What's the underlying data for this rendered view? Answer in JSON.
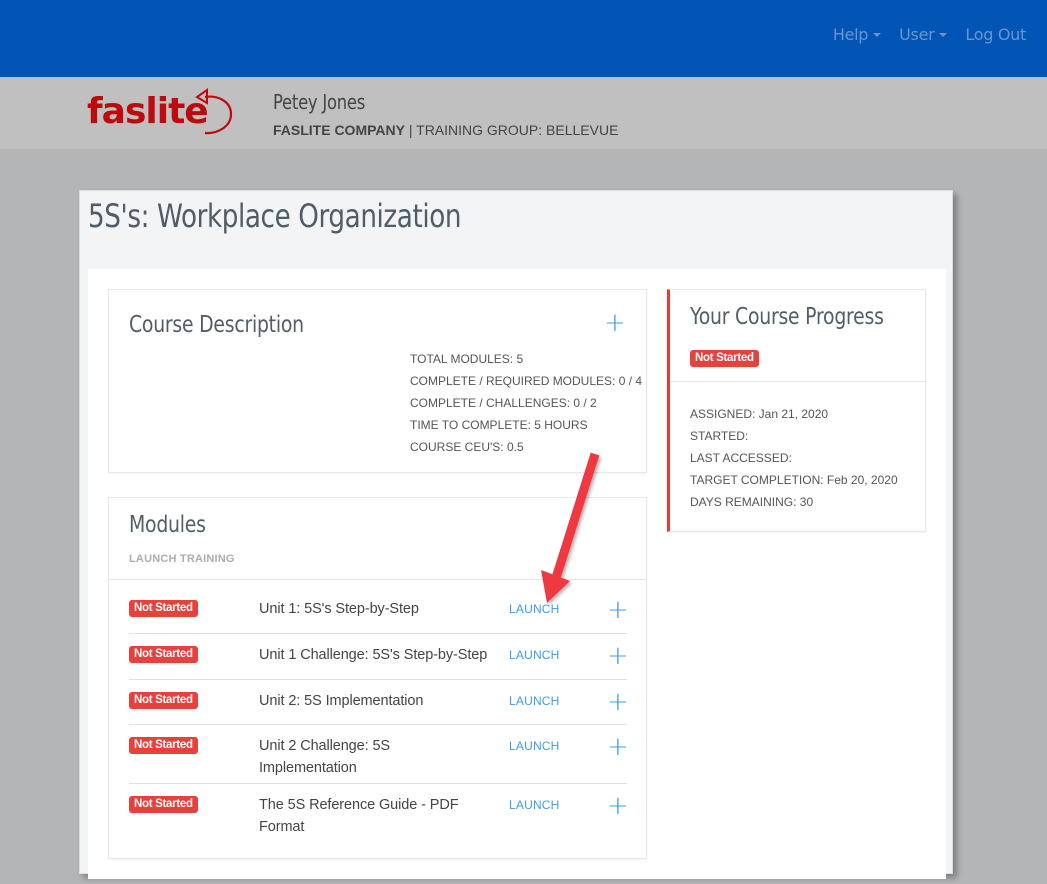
{
  "topnav": {
    "help": "Help",
    "user": "User",
    "logout": "Log Out"
  },
  "logo": {
    "text": "faslite"
  },
  "userbar": {
    "name": "Petey Jones",
    "company": "FASLITE COMPANY",
    "separator": " | ",
    "group": "TRAINING GROUP: BELLEVUE"
  },
  "course": {
    "title": "5S's: Workplace Organization"
  },
  "description": {
    "title": "Course Description",
    "expand_icon": "+",
    "stats": [
      "TOTAL MODULES: 5",
      "COMPLETE / REQUIRED MODULES: 0 / 4",
      "COMPLETE / CHALLENGES: 0 / 2",
      "TIME TO COMPLETE: 5 HOURS",
      "COURSE CEU'S: 0.5"
    ]
  },
  "progress": {
    "title": "Your Course Progress",
    "status": "Not Started",
    "details": [
      "ASSIGNED: Jan 21, 2020",
      "STARTED:",
      "LAST ACCESSED:",
      "TARGET COMPLETION: Feb 20, 2020",
      "DAYS REMAINING: 30"
    ]
  },
  "modules": {
    "title": "Modules",
    "subtitle": "LAUNCH TRAINING",
    "launch_label": "LAUNCH",
    "expand_icon": "+",
    "items": [
      {
        "status": "Not Started",
        "name": "Unit 1: 5S's Step-by-Step"
      },
      {
        "status": "Not Started",
        "name": "Unit 1 Challenge: 5S's Step-by-Step"
      },
      {
        "status": "Not Started",
        "name": "Unit 2: 5S Implementation"
      },
      {
        "status": "Not Started",
        "name": "Unit 2 Challenge: 5S Implementation"
      },
      {
        "status": "Not Started",
        "name": "The 5S Reference Guide - PDF Format"
      }
    ]
  },
  "colors": {
    "topbar": "#0255b5",
    "brand_red": "#be0a0e",
    "badge_red": "#e8403a",
    "link_blue": "#3d9de6",
    "annotation_arrow": "#f0373f"
  }
}
